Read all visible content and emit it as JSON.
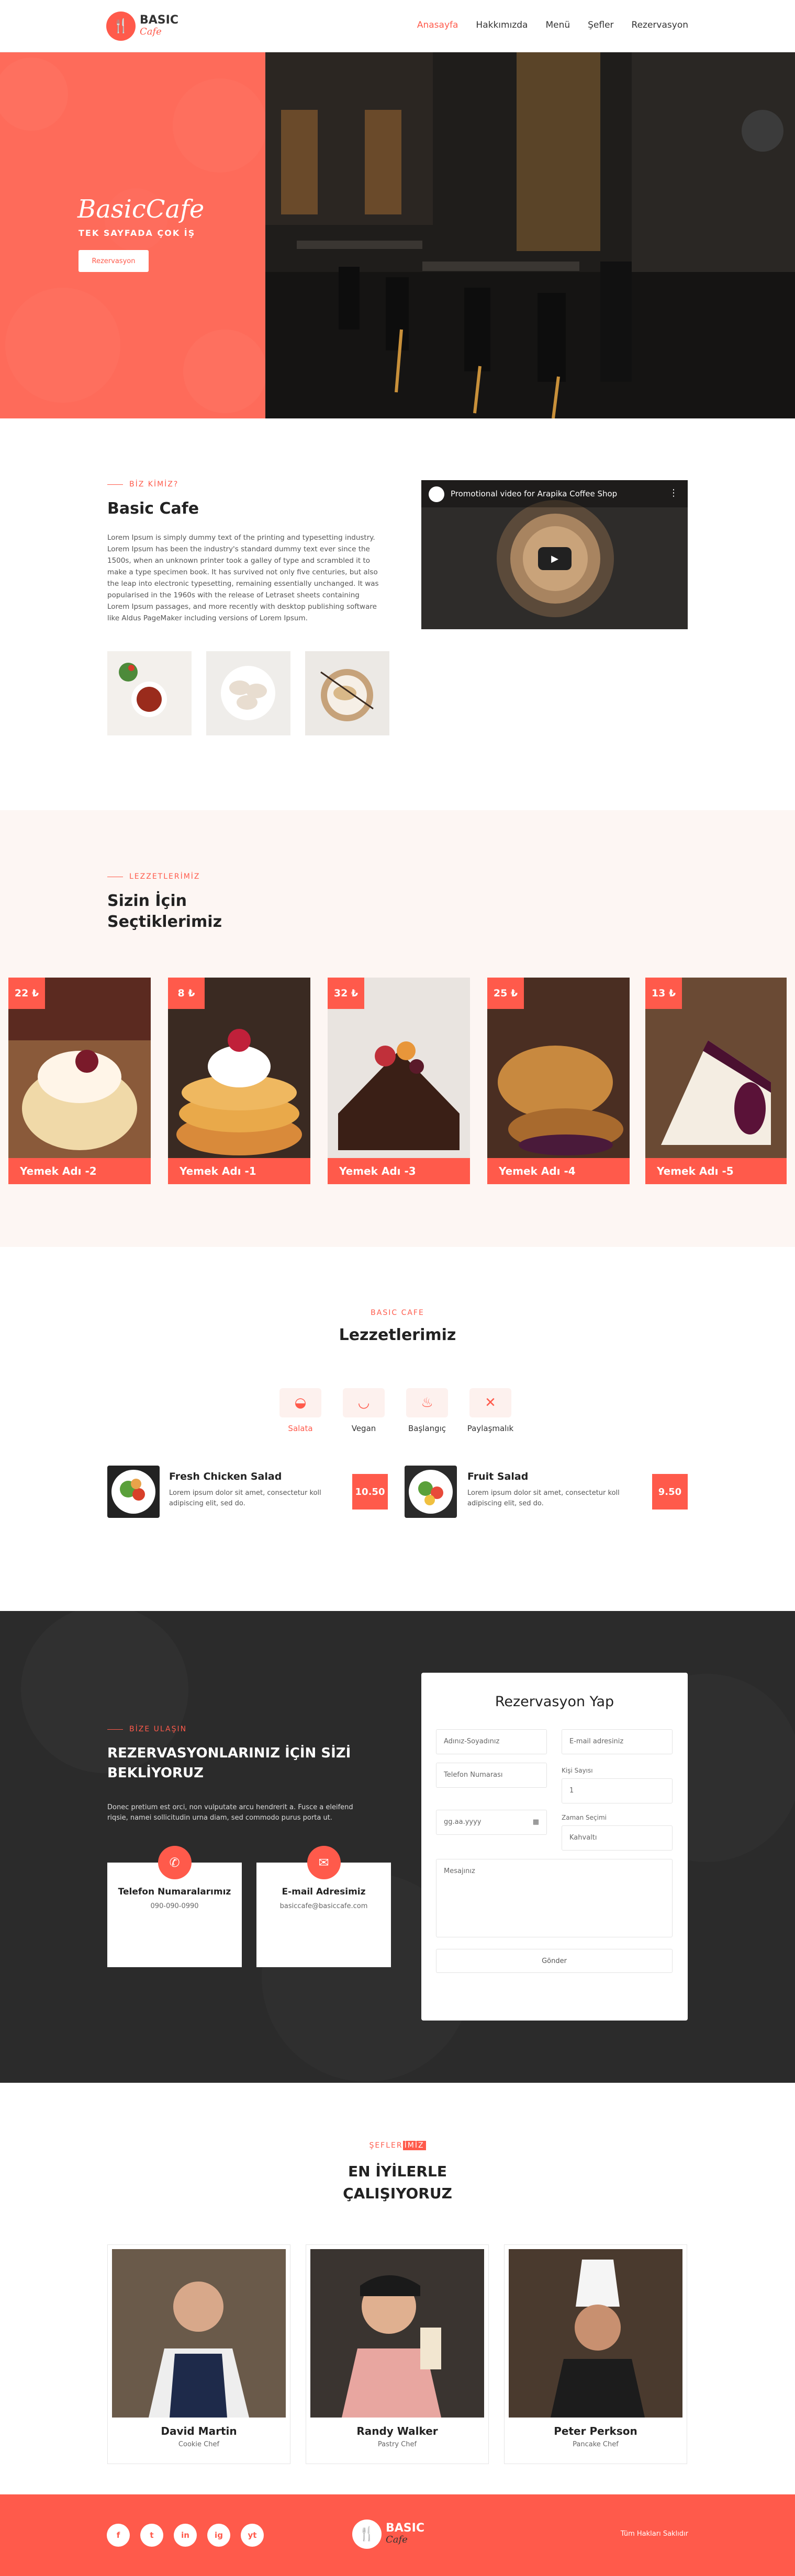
{
  "nav": {
    "logo_top": "BASIC",
    "logo_bottom": "Cafe",
    "items": [
      "Anasayfa",
      "Hakkımızda",
      "Menü",
      "Şefler",
      "Rezervasyon"
    ]
  },
  "hero": {
    "title": "BasicCafe",
    "subtitle": "TEK SAYFADA ÇOK İŞ",
    "button": "Rezervasyon"
  },
  "about": {
    "eyebrow": "BİZ KİMİZ?",
    "title": "Basic Cafe",
    "text": "Lorem Ipsum is simply dummy text of the printing and typesetting industry. Lorem Ipsum has been the industry's standard dummy text ever since the 1500s, when an unknown printer took a galley of type and scrambled it to make a type specimen book. It has survived not only five centuries, but also the leap into electronic typesetting, remaining essentially unchanged. It was popularised in the 1960s with the release of Letraset sheets containing Lorem Ipsum passages, and more recently with desktop publishing software like Aldus PageMaker including versions of Lorem Ipsum.",
    "video_title": "Promotional video for Arapika Coffee Shop"
  },
  "picks": {
    "eyebrow": "LEZZETLERİMİZ",
    "title_line1": "Sizin İçin",
    "title_line2": "Seçtiklerimiz",
    "cards": [
      {
        "price": "22 ₺",
        "name": "Yemek Adı -2"
      },
      {
        "price": "8 ₺",
        "name": "Yemek Adı -1"
      },
      {
        "price": "32 ₺",
        "name": "Yemek Adı -3"
      },
      {
        "price": "25 ₺",
        "name": "Yemek Adı -4"
      },
      {
        "price": "13 ₺",
        "name": "Yemek Adı -5"
      }
    ]
  },
  "menu": {
    "eyebrow": "BASIC CAFE",
    "title": "Lezzetlerimiz",
    "tabs": [
      "Salata",
      "Vegan",
      "Başlangıç",
      "Paylaşmalık"
    ],
    "active_tab": "Salata",
    "dishes": [
      {
        "name": "Fresh Chicken Salad",
        "desc": "Lorem ipsum dolor sit amet, consectetur koll adipiscing elit, sed do.",
        "price": "10.50"
      },
      {
        "name": "Fruit Salad",
        "desc": "Lorem ipsum dolor sit amet, consectetur koll adipiscing elit, sed do.",
        "price": "9.50"
      }
    ]
  },
  "reservation": {
    "eyebrow": "BİZE ULAŞIN",
    "title_line1": "REZERVASYONLARINIZ İÇİN SİZİ",
    "title_line2": "BEKLİYORUZ",
    "text": "Donec pretium est orci, non vulputate arcu hendrerit a. Fusce a eleifend riqsie, namei sollicitudin urna diam, sed commodo purus porta ut.",
    "phone_title": "Telefon Numaralarımız",
    "phone": "090-090-0990",
    "email_title": "E-mail Adresimiz",
    "email": "basiccafe@basiccafe.com",
    "form": {
      "title": "Rezervasyon Yap",
      "name_placeholder": "Adınız-Soyadınız",
      "email_placeholder": "E-mail adresiniz",
      "phone_placeholder": "Telefon Numarası",
      "people_label": "Kişi Sayısı",
      "people_value": "1",
      "date_placeholder": "gg.aa.yyyy",
      "time_label": "Zaman Seçimi",
      "time_value": "Kahvaltı",
      "message_placeholder": "Mesajınız",
      "submit": "Gönder"
    }
  },
  "chefs": {
    "eyebrow_a": "ŞEFLER",
    "eyebrow_b": "İMİZ",
    "title_line1": "EN İYİLERLE",
    "title_line2": "ÇALIŞIYORUZ",
    "items": [
      {
        "name": "David Martin",
        "role": "Cookie Chef"
      },
      {
        "name": "Randy Walker",
        "role": "Pastry Chef"
      },
      {
        "name": "Peter Perkson",
        "role": "Pancake Chef"
      }
    ]
  },
  "footer": {
    "social": [
      "f",
      "t",
      "in",
      "ig",
      "yt"
    ],
    "logo_top": "BASIC",
    "logo_bottom": "Cafe",
    "copyright": "Tüm Hakları Saklıdır"
  },
  "colors": {
    "accent": "#ff5a4b",
    "dark": "#2b2b2b",
    "cream": "#fdf6f3"
  }
}
